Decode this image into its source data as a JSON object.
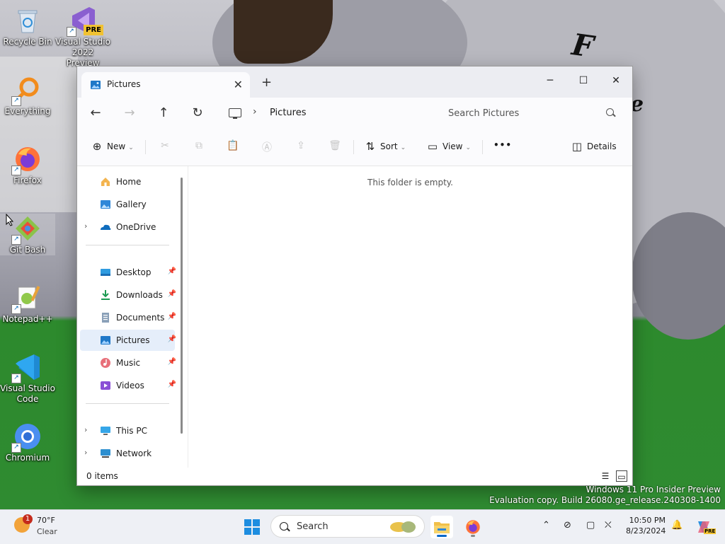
{
  "desktop": {
    "icons": [
      {
        "label": "Recycle Bin",
        "icon": "recycle-bin-icon"
      },
      {
        "label": "Visual Studio 2022 Preview",
        "line1": "Visual Studio",
        "line2": "2022 Preview",
        "badge": "PRE",
        "icon": "visual-studio-icon"
      },
      {
        "label": "Everything",
        "icon": "everything-search-icon"
      },
      {
        "label": "Firefox",
        "icon": "firefox-icon"
      },
      {
        "label": "Git Bash",
        "icon": "git-bash-icon"
      },
      {
        "label": "Notepad++",
        "icon": "notepad-plus-plus-icon"
      },
      {
        "label": "Visual Studio Code",
        "line1": "Visual Studio",
        "line2": "Code",
        "icon": "vscode-icon"
      },
      {
        "label": "Chromium",
        "icon": "chromium-icon"
      }
    ],
    "watermark": {
      "line1": "Windows 11 Pro Insider Preview",
      "line2": "Evaluation copy. Build 26080.ge_release.240308-1400"
    }
  },
  "explorer": {
    "tab_title": "Pictures",
    "new_tab": "+",
    "address": {
      "crumb": "Pictures"
    },
    "search": {
      "placeholder": "Search Pictures"
    },
    "commands": {
      "new": "New",
      "sort": "Sort",
      "view": "View",
      "more": "•••",
      "details": "Details"
    },
    "nav": {
      "home": "Home",
      "gallery": "Gallery",
      "onedrive": "OneDrive",
      "desktop": "Desktop",
      "downloads": "Downloads",
      "documents": "Documents",
      "pictures": "Pictures",
      "music": "Music",
      "videos": "Videos",
      "thispc": "This PC",
      "network": "Network"
    },
    "empty_message": "This folder is empty.",
    "status": {
      "count": "0 items"
    }
  },
  "taskbar": {
    "weather": {
      "temp": "70°F",
      "condition": "Clear",
      "badge": "1"
    },
    "search_label": "Search",
    "clock": {
      "time": "10:50 PM",
      "date": "8/23/2024"
    },
    "copilot_badge": "PRE"
  },
  "colors": {
    "accent": "#0a68c8",
    "selected_nav": "#e5eefa",
    "wallpaper_green": "#2f8b31"
  }
}
